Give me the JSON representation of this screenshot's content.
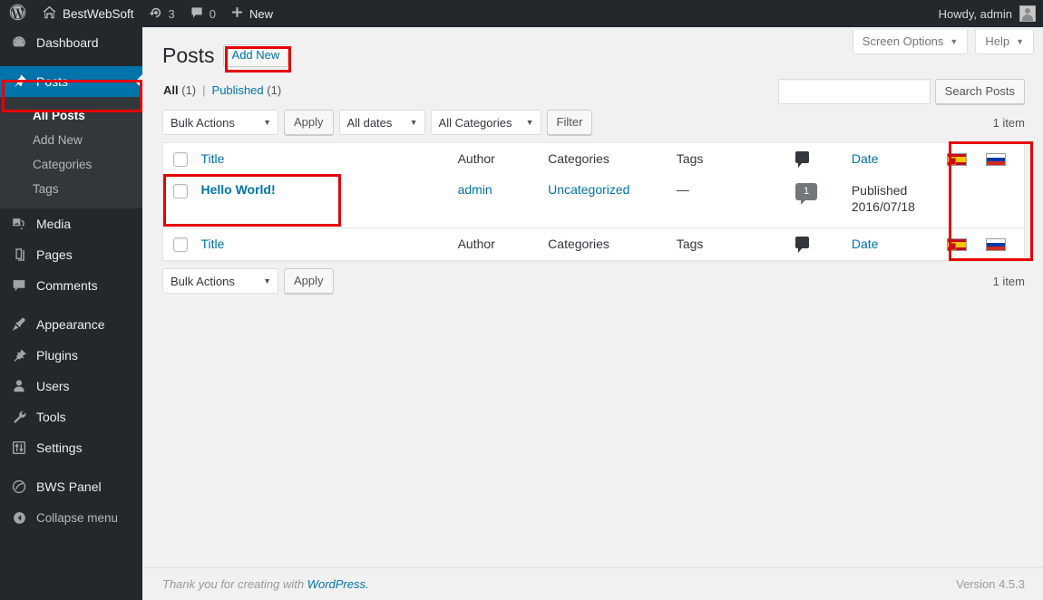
{
  "adminbar": {
    "logo_icon": "wordpress-logo-icon",
    "site_name": "BestWebSoft",
    "home_icon": "home-icon",
    "updates_icon": "updates-icon",
    "updates_count": "3",
    "comments_icon": "comment-icon",
    "comments_count": "0",
    "new_icon": "plus-icon",
    "new_label": "New",
    "howdy": "Howdy, admin",
    "avatar_icon": "avatar-icon"
  },
  "sidebar": {
    "items": [
      {
        "label": "Dashboard",
        "icon": "dashboard-icon",
        "current": false
      },
      {
        "label": "Posts",
        "icon": "pin-icon",
        "current": true
      },
      {
        "label": "Media",
        "icon": "media-icon",
        "current": false
      },
      {
        "label": "Pages",
        "icon": "pages-icon",
        "current": false
      },
      {
        "label": "Comments",
        "icon": "comment-icon",
        "current": false
      },
      {
        "label": "Appearance",
        "icon": "brush-icon",
        "current": false
      },
      {
        "label": "Plugins",
        "icon": "plug-icon",
        "current": false
      },
      {
        "label": "Users",
        "icon": "user-icon",
        "current": false
      },
      {
        "label": "Tools",
        "icon": "wrench-icon",
        "current": false
      },
      {
        "label": "Settings",
        "icon": "sliders-icon",
        "current": false
      },
      {
        "label": "BWS Panel",
        "icon": "bws-icon",
        "current": false
      }
    ],
    "submenu": [
      {
        "label": "All Posts",
        "current": true
      },
      {
        "label": "Add New",
        "current": false
      },
      {
        "label": "Categories",
        "current": false
      },
      {
        "label": "Tags",
        "current": false
      }
    ],
    "collapse": {
      "label": "Collapse menu",
      "icon": "collapse-arrow-icon"
    }
  },
  "screen_meta": {
    "screen_options": "Screen Options",
    "help": "Help",
    "caret": "▼"
  },
  "header": {
    "title": "Posts",
    "add_new": "Add New"
  },
  "views": {
    "all_label": "All",
    "all_count": "(1)",
    "divider": "|",
    "published_label": "Published",
    "published_count": "(1)"
  },
  "search": {
    "value": "",
    "placeholder": "",
    "button": "Search Posts"
  },
  "tablenav_top": {
    "bulk_actions": "Bulk Actions",
    "apply": "Apply",
    "all_dates": "All dates",
    "all_categories": "All Categories",
    "filter": "Filter",
    "displaying_num": "1 item",
    "caret": "▼"
  },
  "tablenav_bottom": {
    "bulk_actions": "Bulk Actions",
    "apply": "Apply",
    "displaying_num": "1 item",
    "caret": "▼"
  },
  "table": {
    "columns": {
      "title": "Title",
      "author": "Author",
      "categories": "Categories",
      "tags": "Tags",
      "comments_icon": "comment-icon",
      "date": "Date",
      "flag_es": "flag-spain-icon",
      "flag_ru": "flag-russia-icon"
    },
    "rows": [
      {
        "title": "Hello World!",
        "author": "admin",
        "categories": "Uncategorized",
        "tags": "—",
        "comments": "1",
        "date_status": "Published",
        "date_value": "2016/07/18"
      }
    ]
  },
  "footer": {
    "thanks_prefix": "Thank you for creating with ",
    "wordpress_link": "WordPress.",
    "version": "Version 4.5.3"
  },
  "annotations": {
    "color": "#e60000",
    "targets": [
      "sidebar-posts",
      "add-new-button",
      "post-row-title",
      "flag-columns"
    ]
  }
}
